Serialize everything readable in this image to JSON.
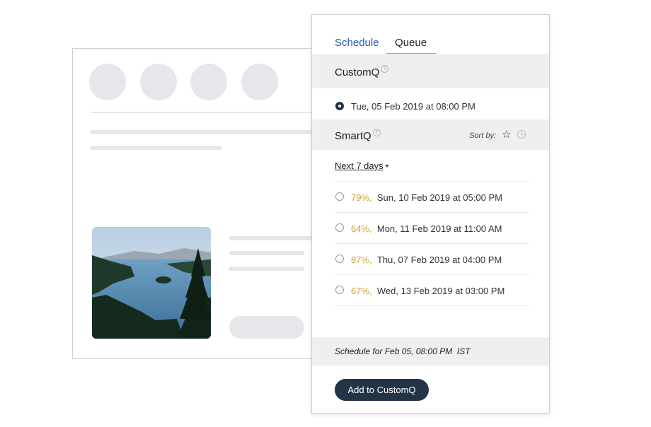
{
  "tabs": {
    "schedule_label": "Schedule",
    "queue_label": "Queue",
    "active": "Queue"
  },
  "customq": {
    "title": "CustomQ",
    "help_glyph": "?",
    "slot": {
      "text": "Tue, 05 Feb 2019 at 08:00 PM",
      "selected": true
    }
  },
  "smartq": {
    "title": "SmartQ",
    "help_glyph": "?",
    "sort_by_label": "Sort by:",
    "sort_icons": [
      "star-icon",
      "clock-icon"
    ],
    "range_label": "Next 7 days",
    "slots": [
      {
        "percent": "79%",
        "time": "Sun, 10 Feb 2019 at 05:00 PM"
      },
      {
        "percent": "64%",
        "time": "Mon, 11 Feb 2019 at 11:00 AM"
      },
      {
        "percent": "87%",
        "time": "Thu, 07 Feb 2019 at 04:00 PM"
      },
      {
        "percent": "67%",
        "time": "Wed, 13 Feb 2019 at 03:00 PM"
      }
    ]
  },
  "footer": {
    "schedule_text": "Schedule for Feb 05, 08:00 PM  IST",
    "add_button_label": "Add to CustomQ"
  },
  "colors": {
    "accent_blue": "#2b5aa8",
    "tab_underline": "#e8953b",
    "percent": "#c9a13a",
    "button_bg": "#243447",
    "band_bg": "#efeff0"
  }
}
